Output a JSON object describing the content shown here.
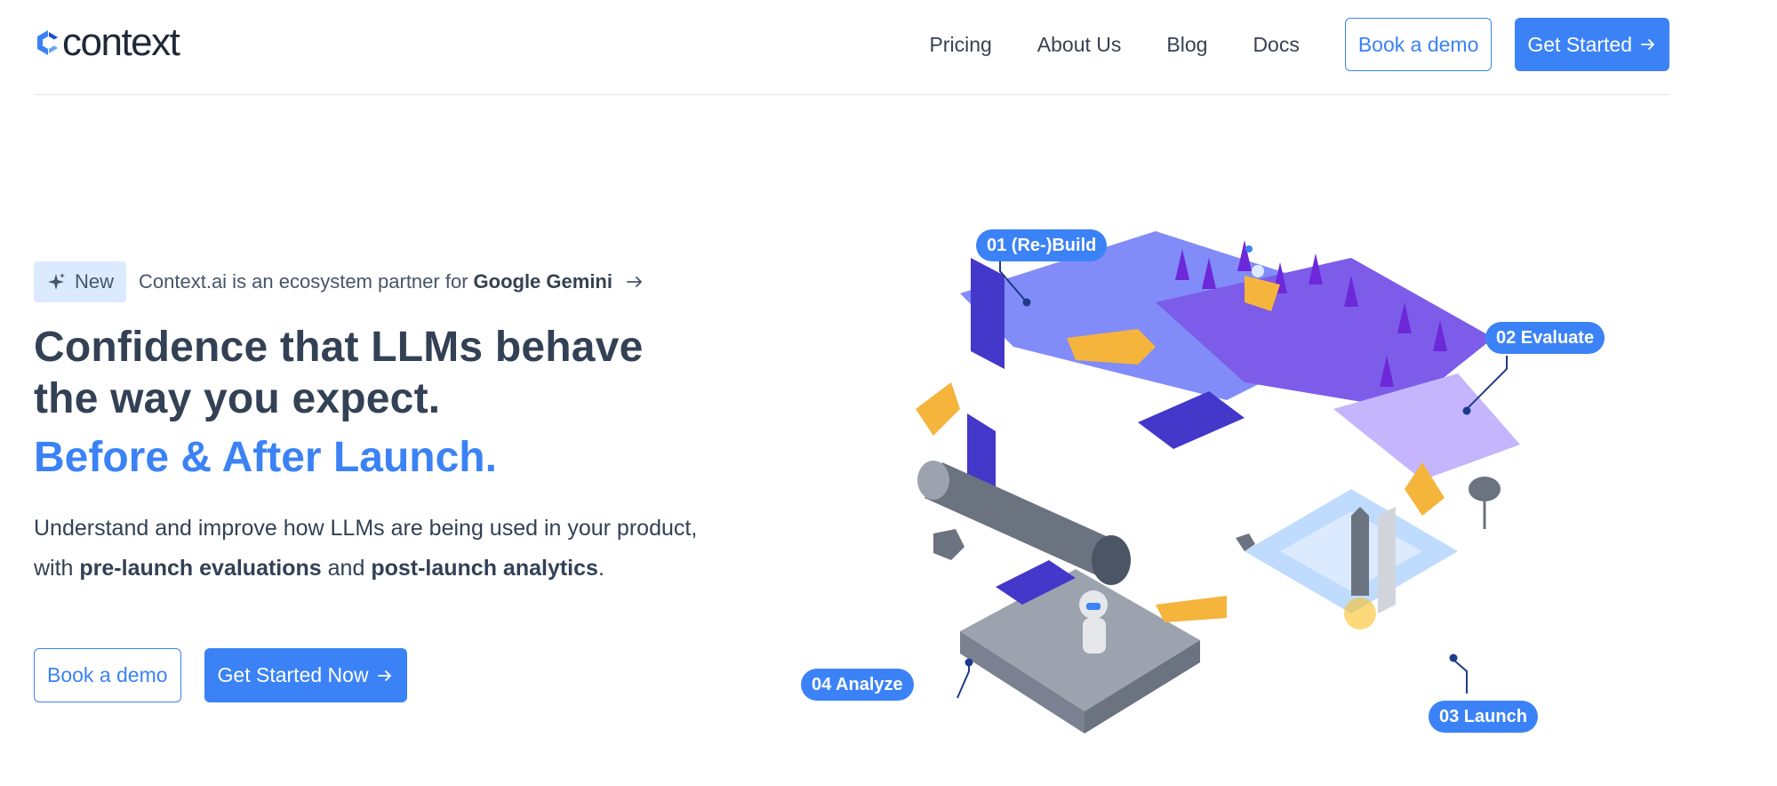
{
  "header": {
    "logo_text": "context",
    "nav": [
      "Pricing",
      "About Us",
      "Blog",
      "Docs"
    ],
    "book_demo": "Book a demo",
    "get_started": "Get Started"
  },
  "hero": {
    "badge": "New",
    "announcement_prefix": "Context.ai is an ecosystem partner for",
    "announcement_bold": "Google Gemini",
    "headline_line1": "Confidence that LLMs behave",
    "headline_line2": "the way you expect.",
    "headline_accent": "Before & After Launch.",
    "sub_1": "Understand and improve how LLMs are being used in your product, with ",
    "sub_bold_1": "pre-launch evaluations",
    "sub_2": " and ",
    "sub_bold_2": "post-launch analytics",
    "sub_3": ".",
    "book_demo": "Book a demo",
    "get_started_now": "Get Started Now"
  },
  "illustration": {
    "steps": [
      "01 (Re-)Build",
      "02 Evaluate",
      "03 Launch",
      "04 Analyze"
    ]
  },
  "colors": {
    "accent": "#3b82f6",
    "text": "#334155",
    "badge_bg": "#dbeafe",
    "purple": "#7c5ce8",
    "orange": "#f5b43c"
  }
}
